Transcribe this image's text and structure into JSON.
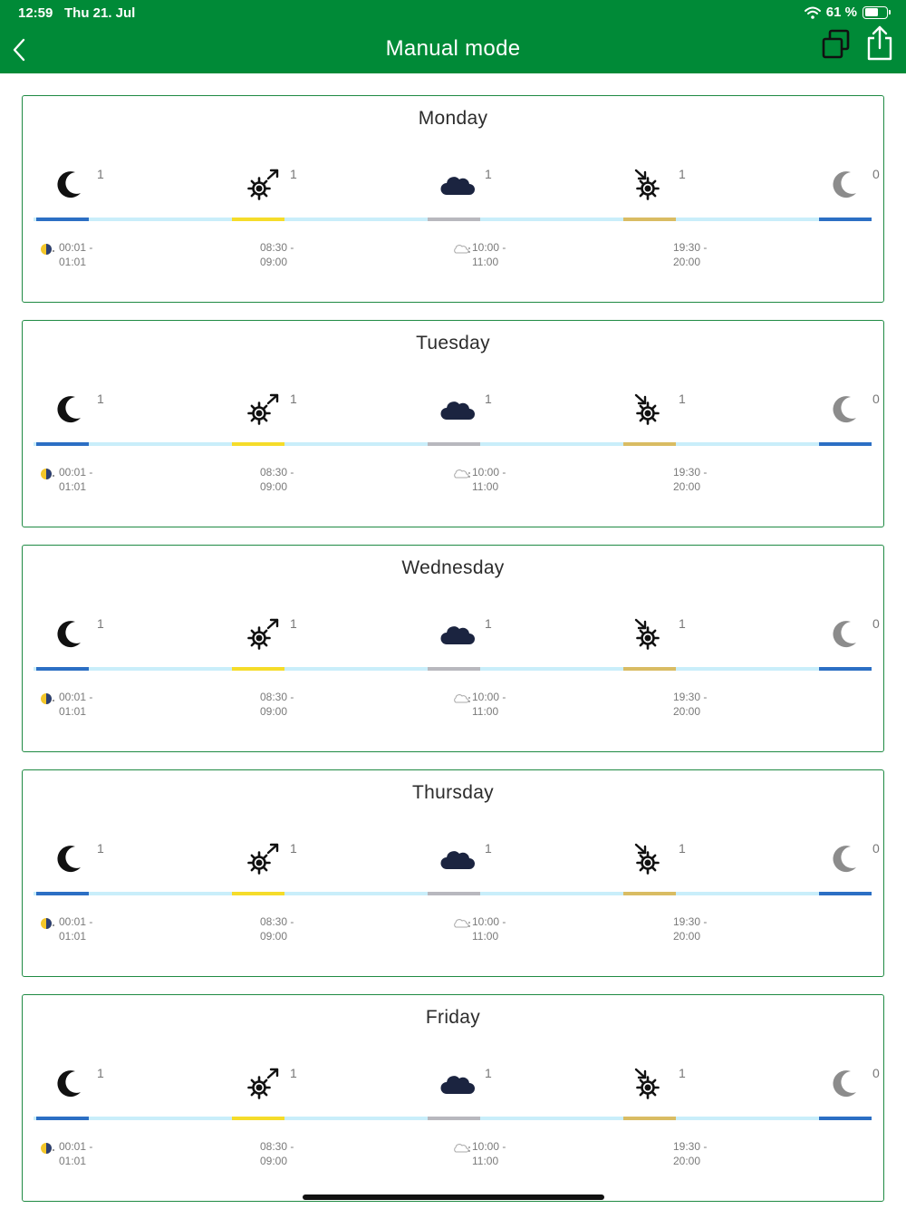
{
  "status_bar": {
    "time": "12:59",
    "date": "Thu 21. Jul",
    "battery": "61 %"
  },
  "header": {
    "title": "Manual mode"
  },
  "colors": {
    "header": "#008a37",
    "card_border": "#1f8a43",
    "night": "#2c6fc4",
    "sunrise": "#f5dc2a",
    "cloud": "#b8b8be",
    "sunset": "#d9bc63",
    "track": "#c9eefa"
  },
  "days": [
    {
      "name": "Monday",
      "segments": [
        {
          "icon": "moon-icon",
          "count": "1"
        },
        {
          "icon": "sun-rising-icon",
          "count": "1"
        },
        {
          "icon": "cloud-icon",
          "count": "1"
        },
        {
          "icon": "sun-setting-icon",
          "count": "1"
        },
        {
          "icon": "moon-inactive-icon",
          "count": "0"
        }
      ],
      "times": [
        {
          "start": "00:01 -",
          "end": "01:01"
        },
        {
          "start": "08:30 -",
          "end": "09:00"
        },
        {
          "start": "10:00 -",
          "end": "11:00"
        },
        {
          "start": "19:30 -",
          "end": "20:00"
        }
      ]
    },
    {
      "name": "Tuesday",
      "segments": [
        {
          "icon": "moon-icon",
          "count": "1"
        },
        {
          "icon": "sun-rising-icon",
          "count": "1"
        },
        {
          "icon": "cloud-icon",
          "count": "1"
        },
        {
          "icon": "sun-setting-icon",
          "count": "1"
        },
        {
          "icon": "moon-inactive-icon",
          "count": "0"
        }
      ],
      "times": [
        {
          "start": "00:01 -",
          "end": "01:01"
        },
        {
          "start": "08:30 -",
          "end": "09:00"
        },
        {
          "start": "10:00 -",
          "end": "11:00"
        },
        {
          "start": "19:30 -",
          "end": "20:00"
        }
      ]
    },
    {
      "name": "Wednesday",
      "segments": [
        {
          "icon": "moon-icon",
          "count": "1"
        },
        {
          "icon": "sun-rising-icon",
          "count": "1"
        },
        {
          "icon": "cloud-icon",
          "count": "1"
        },
        {
          "icon": "sun-setting-icon",
          "count": "1"
        },
        {
          "icon": "moon-inactive-icon",
          "count": "0"
        }
      ],
      "times": [
        {
          "start": "00:01 -",
          "end": "01:01"
        },
        {
          "start": "08:30 -",
          "end": "09:00"
        },
        {
          "start": "10:00 -",
          "end": "11:00"
        },
        {
          "start": "19:30 -",
          "end": "20:00"
        }
      ]
    },
    {
      "name": "Thursday",
      "segments": [
        {
          "icon": "moon-icon",
          "count": "1"
        },
        {
          "icon": "sun-rising-icon",
          "count": "1"
        },
        {
          "icon": "cloud-icon",
          "count": "1"
        },
        {
          "icon": "sun-setting-icon",
          "count": "1"
        },
        {
          "icon": "moon-inactive-icon",
          "count": "0"
        }
      ],
      "times": [
        {
          "start": "00:01 -",
          "end": "01:01"
        },
        {
          "start": "08:30 -",
          "end": "09:00"
        },
        {
          "start": "10:00 -",
          "end": "11:00"
        },
        {
          "start": "19:30 -",
          "end": "20:00"
        }
      ]
    },
    {
      "name": "Friday",
      "segments": [
        {
          "icon": "moon-icon",
          "count": "1"
        },
        {
          "icon": "sun-rising-icon",
          "count": "1"
        },
        {
          "icon": "cloud-icon",
          "count": "1"
        },
        {
          "icon": "sun-setting-icon",
          "count": "1"
        },
        {
          "icon": "moon-inactive-icon",
          "count": "0"
        }
      ],
      "times": [
        {
          "start": "00:01 -",
          "end": "01:01"
        },
        {
          "start": "08:30 -",
          "end": "09:00"
        },
        {
          "start": "10:00 -",
          "end": "11:00"
        },
        {
          "start": "19:30 -",
          "end": "20:00"
        }
      ]
    }
  ]
}
